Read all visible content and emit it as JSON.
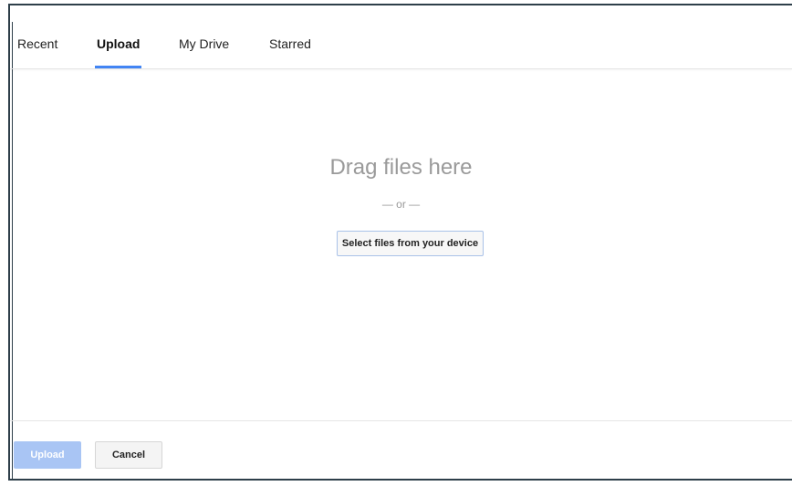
{
  "tabs": [
    {
      "label": "Recent",
      "active": false
    },
    {
      "label": "Upload",
      "active": true
    },
    {
      "label": "My Drive",
      "active": false
    },
    {
      "label": "Starred",
      "active": false
    }
  ],
  "dropzone": {
    "title": "Drag files here",
    "or_text": "— or —",
    "select_button_label": "Select files from your device"
  },
  "footer": {
    "upload_label": "Upload",
    "upload_enabled": false,
    "cancel_label": "Cancel"
  },
  "colors": {
    "accent": "#4285f4",
    "upload_disabled_bg": "#a9c5f4",
    "frame_border": "#2e3f4a"
  }
}
